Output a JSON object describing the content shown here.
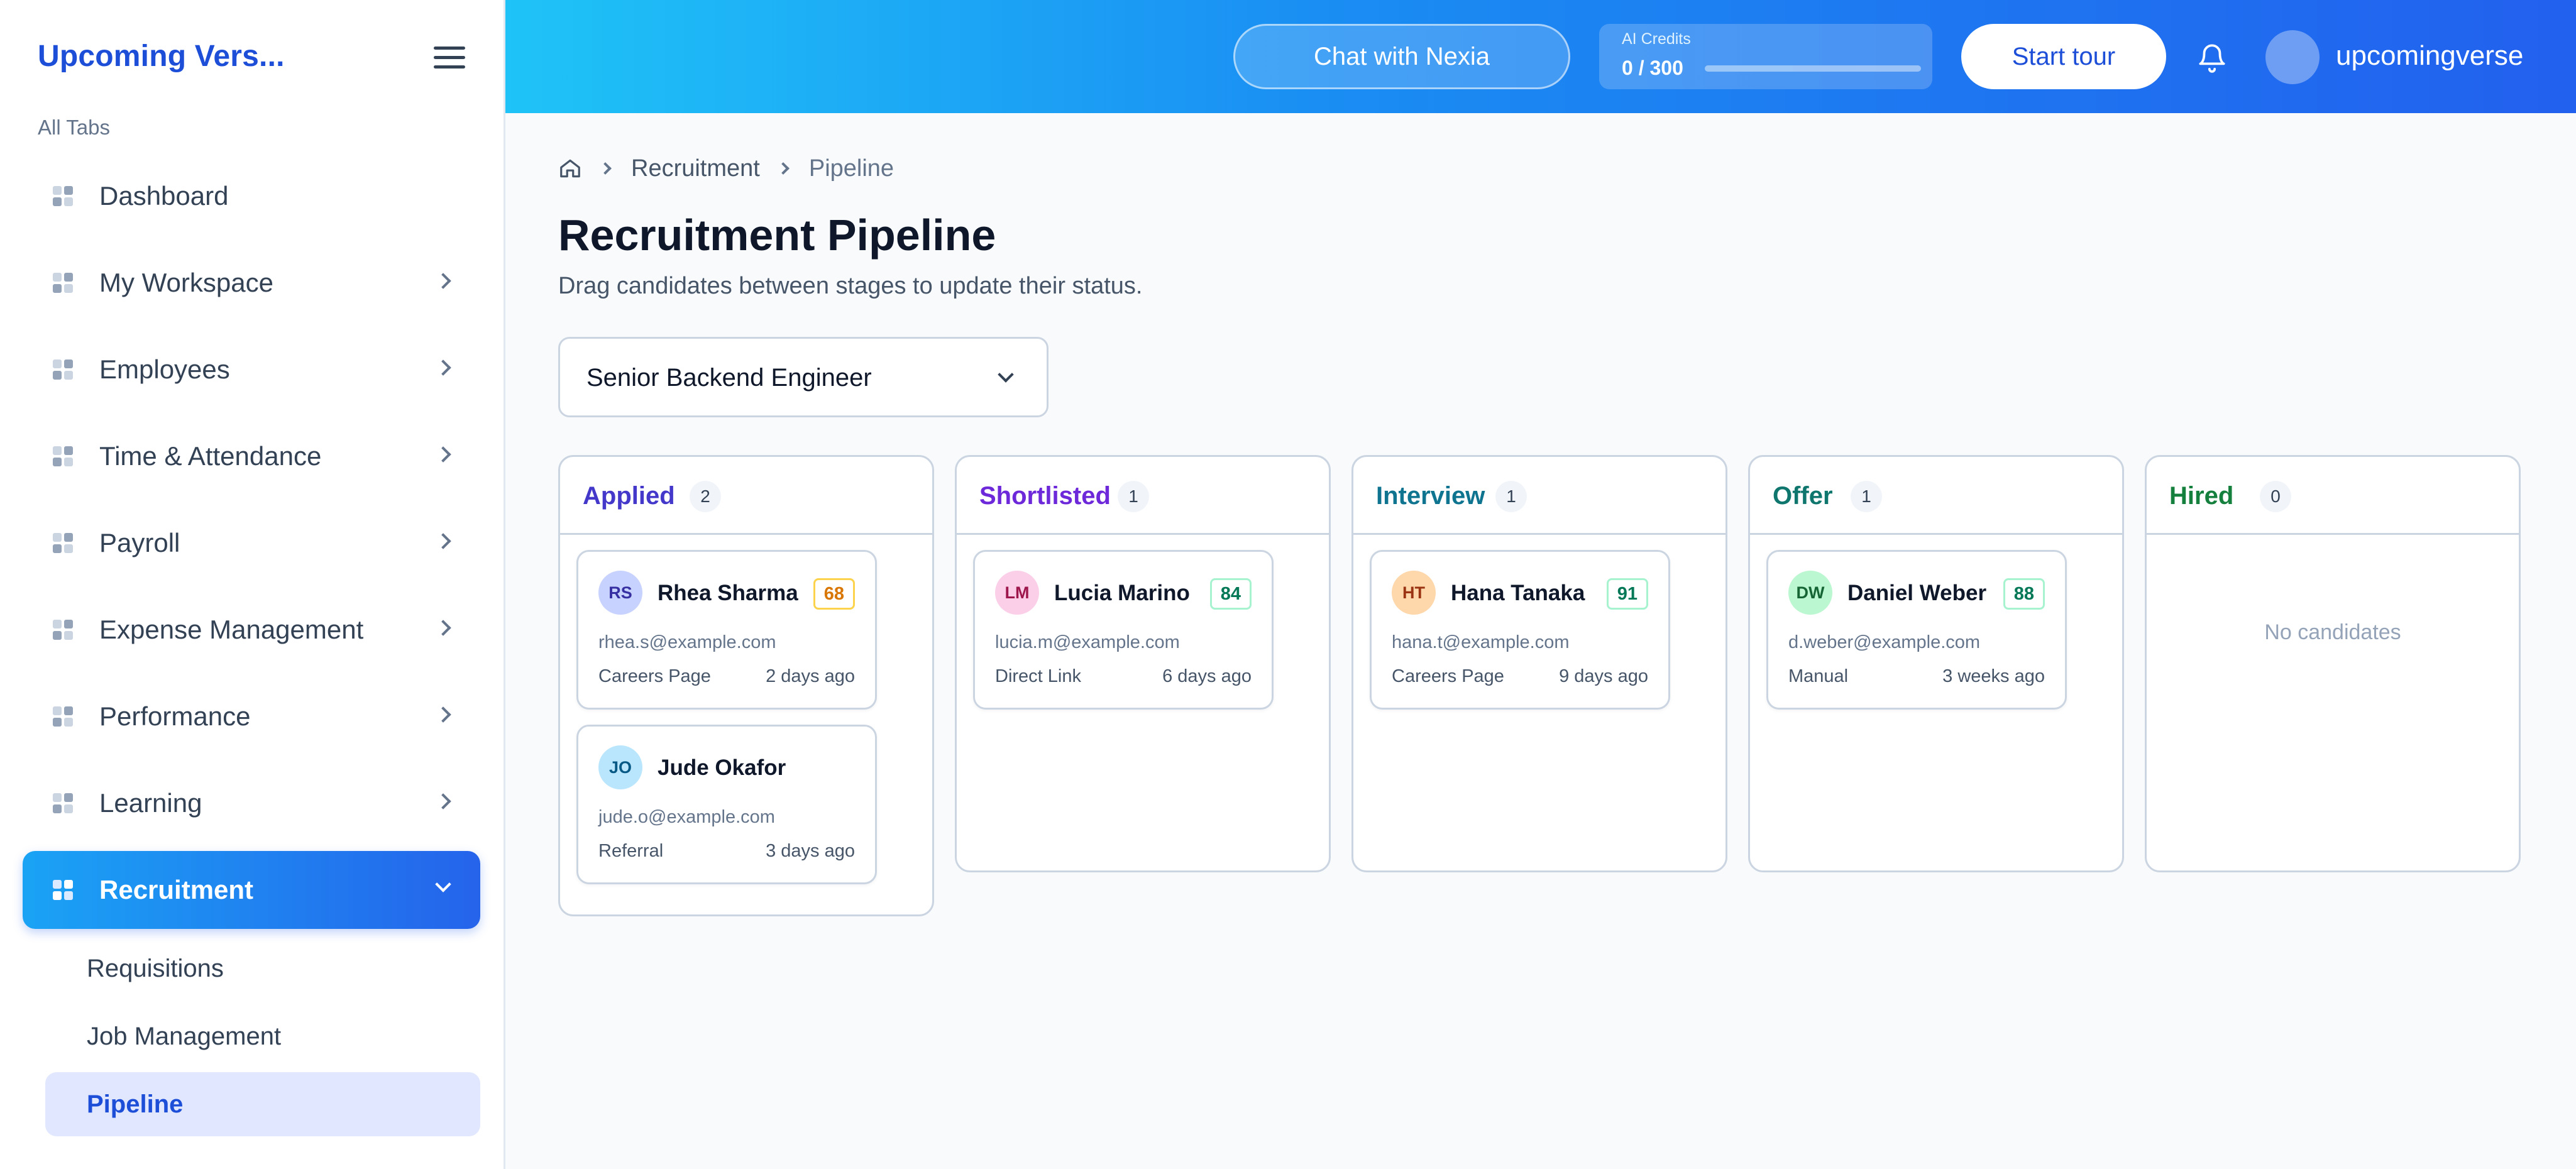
{
  "sidebar": {
    "brand": "Upcoming Vers...",
    "section_label": "All Tabs",
    "items": [
      {
        "label": "Dashboard"
      },
      {
        "label": "My Workspace"
      },
      {
        "label": "Employees"
      },
      {
        "label": "Time & Attendance"
      },
      {
        "label": "Payroll"
      },
      {
        "label": "Expense Management"
      },
      {
        "label": "Performance"
      },
      {
        "label": "Learning"
      },
      {
        "label": "Recruitment"
      }
    ],
    "sub_items": [
      {
        "label": "Requisitions"
      },
      {
        "label": "Job Management"
      },
      {
        "label": "Pipeline"
      }
    ]
  },
  "topbar": {
    "chat_label": "Chat with Nexia",
    "credits_title": "AI Credits",
    "credits_value": "0 / 300",
    "credits_used_fraction": 0,
    "tour_label": "Start tour",
    "username": "upcomingverse"
  },
  "breadcrumb": {
    "items": [
      {
        "label": "Recruitment"
      },
      {
        "label": "Pipeline"
      }
    ]
  },
  "page": {
    "title": "Recruitment Pipeline",
    "subtitle": "Drag candidates between stages to update their status.",
    "job_select_value": "Senior Backend Engineer"
  },
  "columns": [
    {
      "title": "Applied",
      "count": "2",
      "color": "#4338ca",
      "empty_label": "",
      "cards": [
        {
          "initials": "RS",
          "name": "Rhea Sharma",
          "score": "68",
          "email": "rhea.s@example.com",
          "source": "Careers Page",
          "ago": "2 days ago",
          "avatar_bg": "#c7d2fe",
          "avatar_fg": "#3730a3",
          "score_color": "#d97706",
          "score_border": "#fcd34d"
        },
        {
          "initials": "JO",
          "name": "Jude Okafor",
          "score": "",
          "email": "jude.o@example.com",
          "source": "Referral",
          "ago": "3 days ago",
          "avatar_bg": "#bae6fd",
          "avatar_fg": "#075985",
          "score_color": "",
          "score_border": ""
        }
      ]
    },
    {
      "title": "Shortlisted",
      "count": "1",
      "color": "#6d28d9",
      "empty_label": "",
      "cards": [
        {
          "initials": "LM",
          "name": "Lucia Marino",
          "score": "84",
          "email": "lucia.m@example.com",
          "source": "Direct Link",
          "ago": "6 days ago",
          "avatar_bg": "#fbcfe8",
          "avatar_fg": "#9d174d",
          "score_color": "#047857",
          "score_border": "#a7f3d0"
        }
      ]
    },
    {
      "title": "Interview",
      "count": "1",
      "color": "#0e7490",
      "empty_label": "",
      "cards": [
        {
          "initials": "HT",
          "name": "Hana Tanaka",
          "score": "91",
          "email": "hana.t@example.com",
          "source": "Careers Page",
          "ago": "9 days ago",
          "avatar_bg": "#fed7aa",
          "avatar_fg": "#9a3412",
          "score_color": "#047857",
          "score_border": "#a7f3d0"
        }
      ]
    },
    {
      "title": "Offer",
      "count": "1",
      "color": "#0f766e",
      "empty_label": "",
      "cards": [
        {
          "initials": "DW",
          "name": "Daniel Weber",
          "score": "88",
          "email": "d.weber@example.com",
          "source": "Manual",
          "ago": "3 weeks ago",
          "avatar_bg": "#bbf7d0",
          "avatar_fg": "#166534",
          "score_color": "#047857",
          "score_border": "#a7f3d0"
        }
      ]
    },
    {
      "title": "Hired",
      "count": "0",
      "color": "#15803d",
      "empty_label": "No candidates",
      "cards": []
    }
  ]
}
